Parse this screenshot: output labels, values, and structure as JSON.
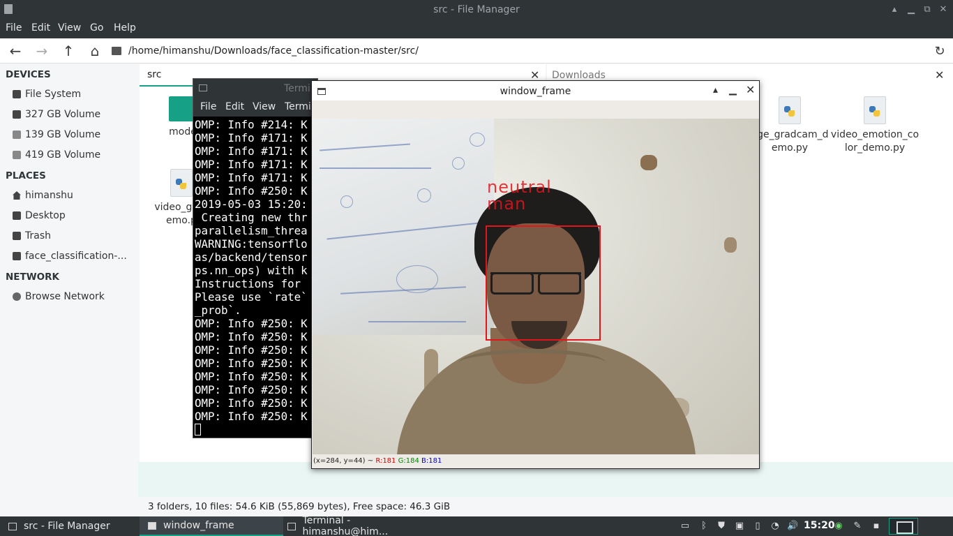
{
  "fm": {
    "title": "src - File Manager",
    "menu": [
      "File",
      "Edit",
      "View",
      "Go",
      "Help"
    ],
    "path": "/home/himanshu/Downloads/face_classification-master/src/",
    "sidebar": {
      "devices_head": "DEVICES",
      "devices": [
        "File System",
        "327 GB Volume",
        "139 GB Volume",
        "419 GB Volume"
      ],
      "places_head": "PLACES",
      "places": [
        "himanshu",
        "Desktop",
        "Trash",
        "face_classification-..."
      ],
      "network_head": "NETWORK",
      "network": [
        "Browse Network"
      ]
    },
    "tabs": {
      "left": "src",
      "right": "Downloads"
    },
    "files": {
      "models": "mode",
      "video_grad_line1": "video_grad",
      "video_grad_line2": "emo.p",
      "image_gradcam_line1": "age_gradcam_d",
      "image_gradcam_line2": "emo.py",
      "video_emotion_line1": "video_emotion_co",
      "video_emotion_line2": "lor_demo.py"
    },
    "status": "3 folders, 10 files: 54.6 KiB (55,869 bytes), Free space: 46.3 GiB"
  },
  "terminal": {
    "title": "Termi",
    "menu": [
      "File",
      "Edit",
      "View",
      "Termi"
    ],
    "lines": [
      "OMP: Info #214: K",
      "OMP: Info #171: K",
      "OMP: Info #171: K",
      "OMP: Info #171: K",
      "OMP: Info #171: K",
      "OMP: Info #250: K",
      "2019-05-03 15:20:",
      " Creating new thr",
      "parallelism_threa",
      "WARNING:tensorflo",
      "as/backend/tensor",
      "ps.nn_ops) with k",
      "Instructions for ",
      "Please use `rate`",
      "_prob`.",
      "OMP: Info #250: K",
      "OMP: Info #250: K",
      "OMP: Info #250: K",
      "OMP: Info #250: K",
      "OMP: Info #250: K",
      "OMP: Info #250: K",
      "OMP: Info #250: K",
      "OMP: Info #250: K"
    ]
  },
  "window_frame": {
    "title": "window_frame",
    "emotion": "neutral",
    "gender": "man",
    "status_coords": "(x=284, y=44) ~",
    "status_r": "R:181",
    "status_g": "G:184",
    "status_b": "B:181"
  },
  "taskbar": {
    "tasks": [
      "src - File Manager",
      "window_frame",
      "Terminal - himanshu@him..."
    ],
    "clock": "15:20"
  },
  "colors": {
    "accent": "#16a085",
    "facebox": "#e0161d",
    "dark": "#2f3437"
  }
}
